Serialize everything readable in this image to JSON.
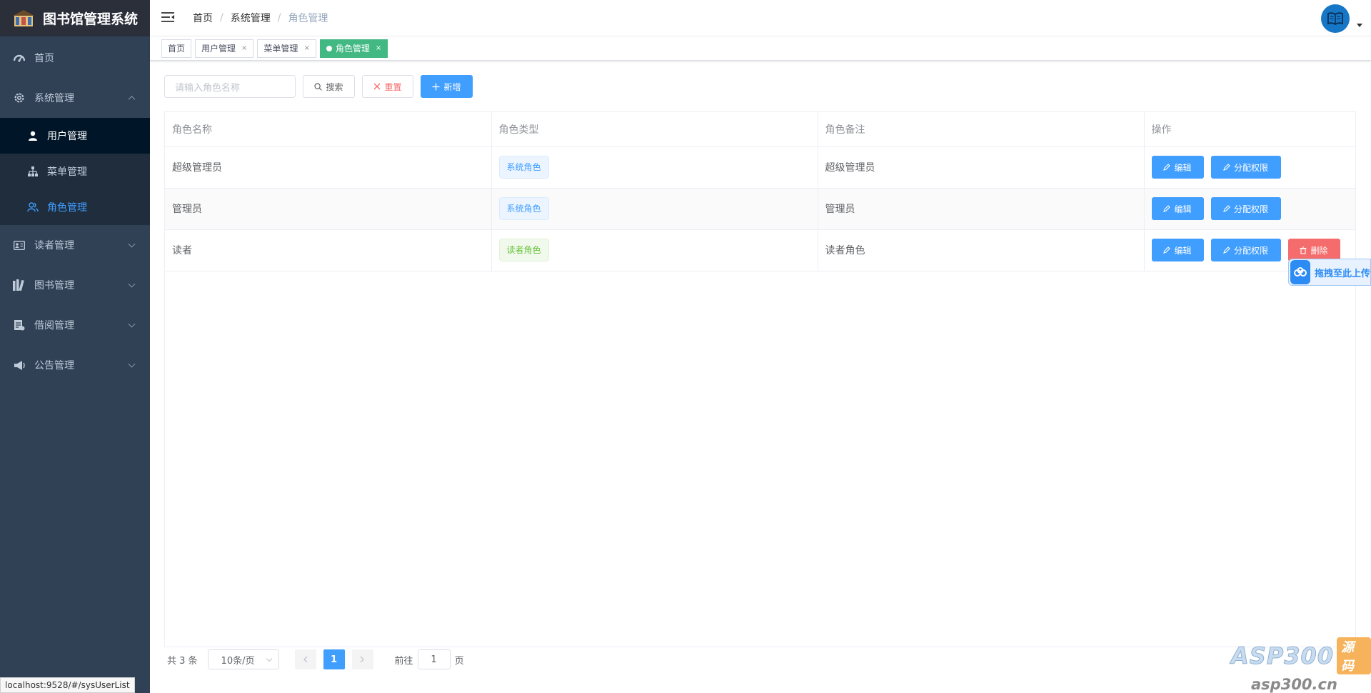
{
  "app": {
    "title": "图书馆管理系统"
  },
  "sidebar": {
    "items": [
      {
        "label": "首页",
        "icon": "dashboard-icon"
      },
      {
        "label": "系统管理",
        "icon": "gear-icon",
        "expanded": true,
        "children": [
          {
            "label": "用户管理",
            "icon": "user-icon"
          },
          {
            "label": "菜单管理",
            "icon": "tree-icon"
          },
          {
            "label": "角色管理",
            "icon": "peoples-icon",
            "active": true
          }
        ]
      },
      {
        "label": "读者管理",
        "icon": "id-card-icon"
      },
      {
        "label": "图书管理",
        "icon": "books-icon"
      },
      {
        "label": "借阅管理",
        "icon": "document-icon"
      },
      {
        "label": "公告管理",
        "icon": "megaphone-icon"
      }
    ]
  },
  "header": {
    "breadcrumb": [
      "首页",
      "系统管理",
      "角色管理"
    ]
  },
  "tags": [
    {
      "label": "首页"
    },
    {
      "label": "用户管理",
      "close": "×"
    },
    {
      "label": "菜单管理",
      "close": "×"
    },
    {
      "label": "角色管理",
      "close": "×",
      "active": true
    }
  ],
  "toolbar": {
    "search_placeholder": "请输入角色名称",
    "search_label": "搜索",
    "reset_label": "重置",
    "add_label": "新增"
  },
  "table": {
    "headers": [
      "角色名称",
      "角色类型",
      "角色备注",
      "操作"
    ],
    "rows": [
      {
        "name": "超级管理员",
        "type": "系统角色",
        "remark": "超级管理员"
      },
      {
        "name": "管理员",
        "type": "系统角色",
        "remark": "管理员"
      },
      {
        "name": "读者",
        "type": "读者角色",
        "remark": "读者角色"
      }
    ],
    "edit_label": "编辑",
    "perm_label": "分配权限",
    "delete_label": "删除"
  },
  "pagination": {
    "total": "共 3 条",
    "page_size": "10条/页",
    "current_page": "1",
    "goto_prefix": "前往",
    "goto_value": "1",
    "goto_suffix": "页"
  },
  "status_bar": {
    "url": "localhost:9528/#/sysUserList"
  },
  "upload_widget": {
    "label": "拖拽至此上传"
  },
  "watermark": {
    "brand": "ASP300",
    "badge": "源码",
    "url": "asp300.cn"
  },
  "colors": {
    "primary": "#409eff",
    "danger": "#f56c6c",
    "success": "#67c23a",
    "sidebar": "#304156",
    "tag_active": "#42b983"
  }
}
